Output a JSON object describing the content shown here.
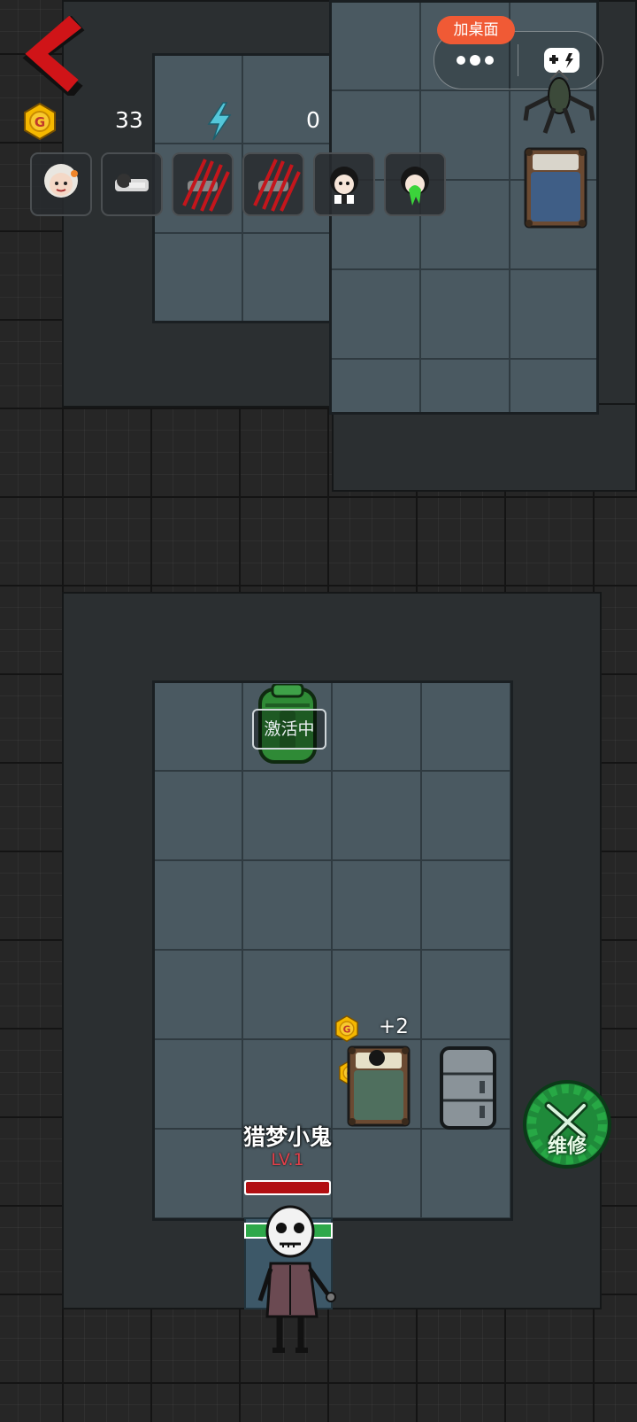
{
  "header": {
    "back_icon": "red-back-chevron-icon",
    "add_to_desktop_label": "加桌面",
    "more_icon": "more-dots-icon",
    "game_icon": "gamepad-icon"
  },
  "resources": {
    "coin_icon": "gold-coin-icon",
    "coin_value": "33",
    "energy_icon": "lightning-icon",
    "energy_value": "0"
  },
  "character_slots": [
    {
      "icon": "old-woman-portrait-icon"
    },
    {
      "icon": "sleeping-character-icon"
    },
    {
      "icon": "scratched-character-icon"
    },
    {
      "icon": "scratched-character-icon"
    },
    {
      "icon": "girl-portrait-icon"
    },
    {
      "icon": "infected-character-icon"
    }
  ],
  "map": {
    "generator": {
      "icon": "green-generator-icon",
      "status": "激活中"
    },
    "bed_top": {
      "icon": "bed-icon"
    },
    "bed_player": {
      "icon": "occupied-bed-icon"
    },
    "fridge": {
      "icon": "fridge-icon"
    },
    "gains": [
      "+2",
      "+2"
    ]
  },
  "enemy": {
    "name": "猎梦小鬼",
    "level": "LV.1",
    "hp_fraction": 1.0,
    "icon": "ghost-hunter-icon"
  },
  "repair_button": {
    "label": "维修",
    "icon": "wrench-gear-icon"
  },
  "colors": {
    "accent": "#f05a35",
    "back": "#d01418",
    "repair": "#1f8a3a",
    "hp": "#b20f12"
  }
}
